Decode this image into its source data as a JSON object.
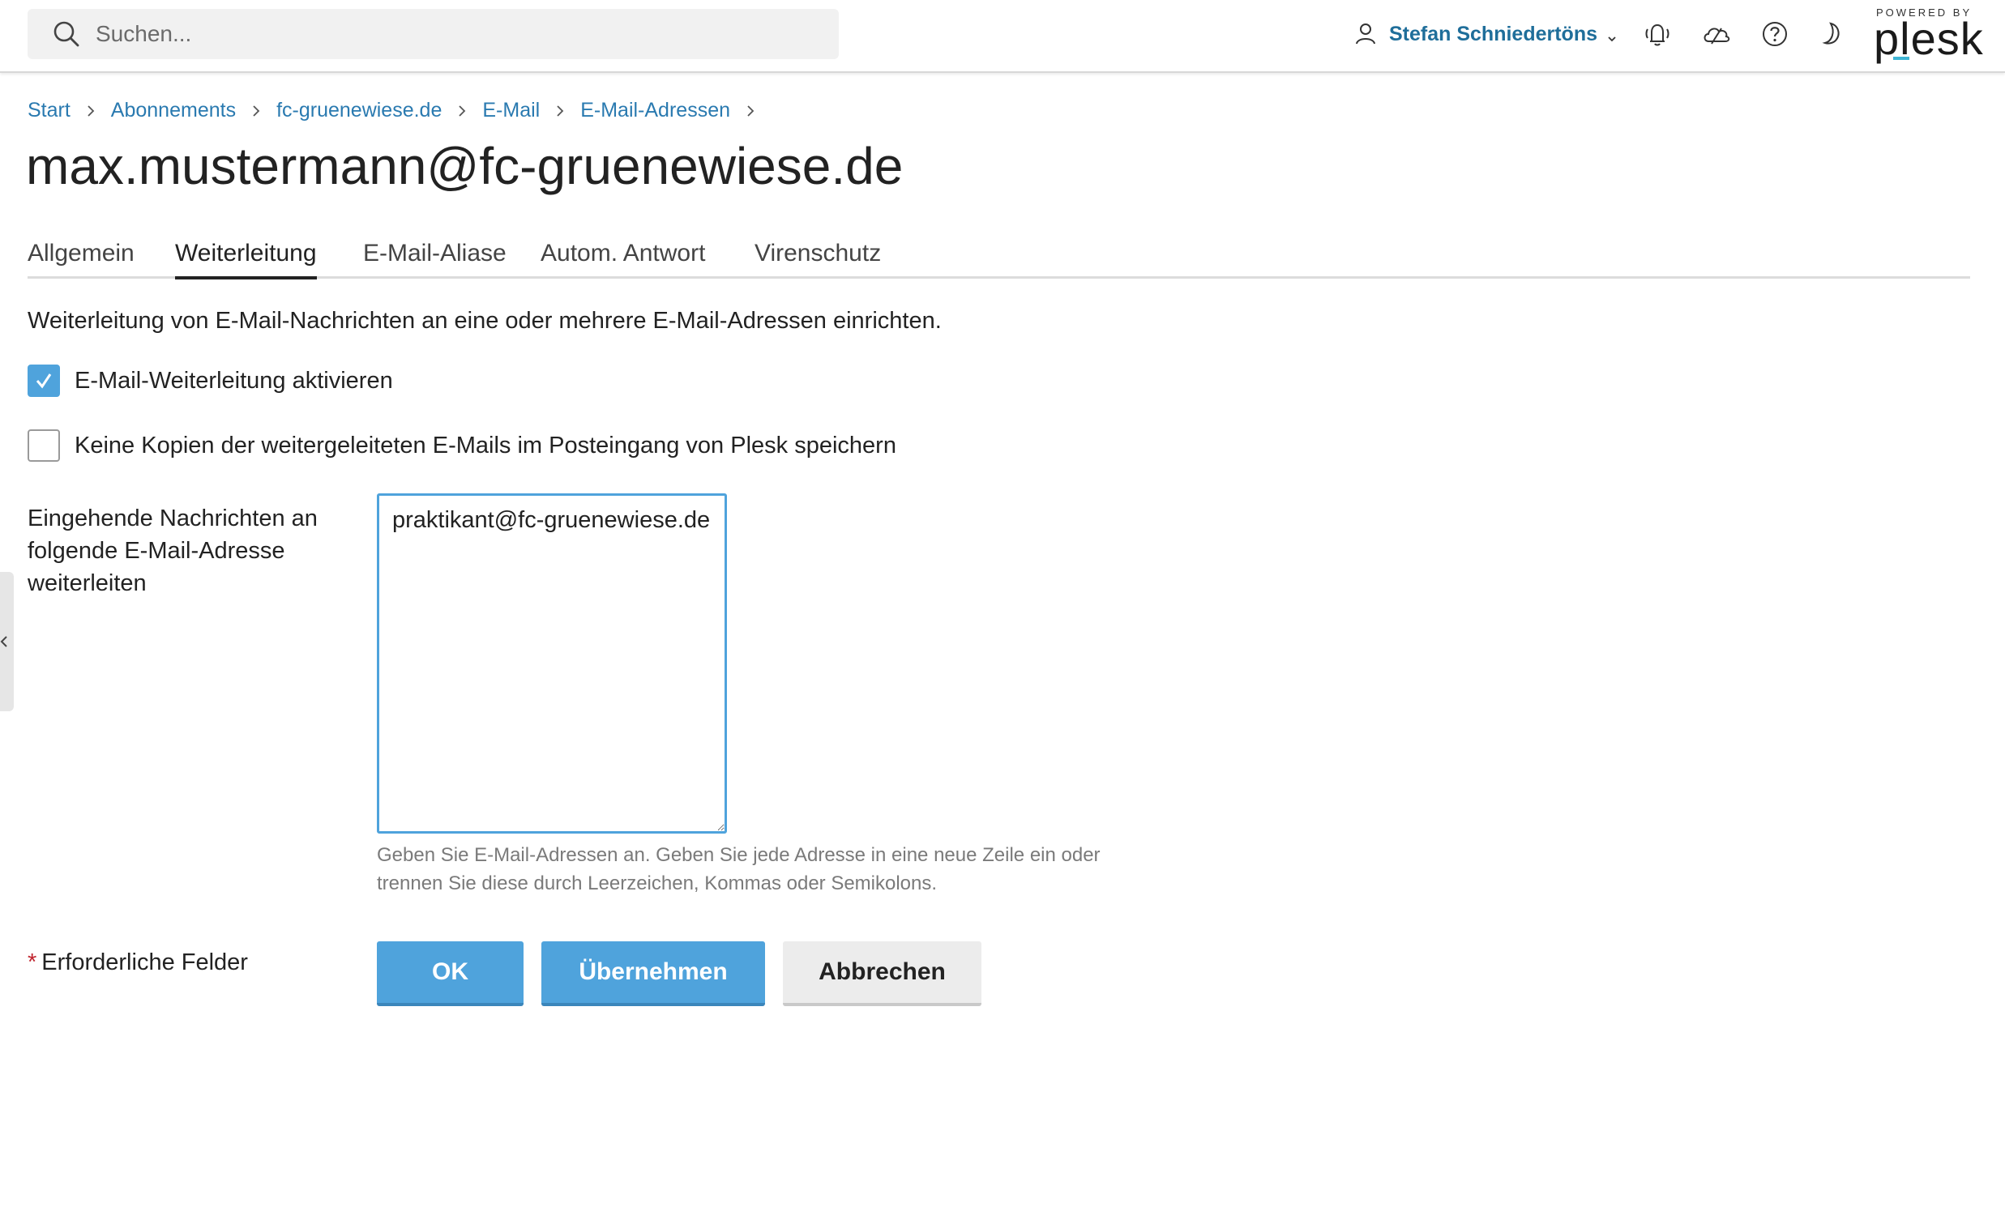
{
  "header": {
    "search_placeholder": "Suchen...",
    "user_name": "Stefan Schniedertöns",
    "logo_powered": "POWERED BY",
    "logo_word": "plesk"
  },
  "breadcrumb": [
    {
      "label": "Start"
    },
    {
      "label": "Abonnements"
    },
    {
      "label": "fc-gruenewiese.de"
    },
    {
      "label": "E-Mail"
    },
    {
      "label": "E-Mail-Adressen"
    }
  ],
  "page_title": "max.mustermann@fc-gruenewiese.de",
  "tabs": [
    {
      "label": "Allgemein",
      "active": false
    },
    {
      "label": "Weiterleitung",
      "active": true
    },
    {
      "label": "E-Mail-Aliase",
      "active": false
    },
    {
      "label": "Autom. Antwort",
      "active": false
    },
    {
      "label": "Virenschutz",
      "active": false
    }
  ],
  "content": {
    "intro": "Weiterleitung von E-Mail-Nachrichten an eine oder mehrere E-Mail-Adressen einrichten.",
    "checkboxes": [
      {
        "label": "E-Mail-Weiterleitung aktivieren",
        "checked": true
      },
      {
        "label": "Keine Kopien der weitergeleiteten E-Mails im Posteingang von Plesk speichern",
        "checked": false
      }
    ],
    "forward_field": {
      "label": "Eingehende Nachrichten an folgende E-Mail-Adresse weiterleiten",
      "value": "praktikant@fc-gruenewiese.de",
      "hint": "Geben Sie E-Mail-Adressen an. Geben Sie jede Adresse in eine neue Zeile ein oder trennen Sie diese durch Leerzeichen, Kommas oder Semikolons."
    },
    "required_star": "*",
    "required_note": "Erforderliche Felder"
  },
  "buttons": {
    "ok": "OK",
    "apply": "Übernehmen",
    "cancel": "Abbrechen"
  },
  "colors": {
    "link": "#2a7ab0",
    "primary": "#4fa3dc",
    "required": "#c0242e",
    "logo_accent": "#3fb5d4"
  }
}
